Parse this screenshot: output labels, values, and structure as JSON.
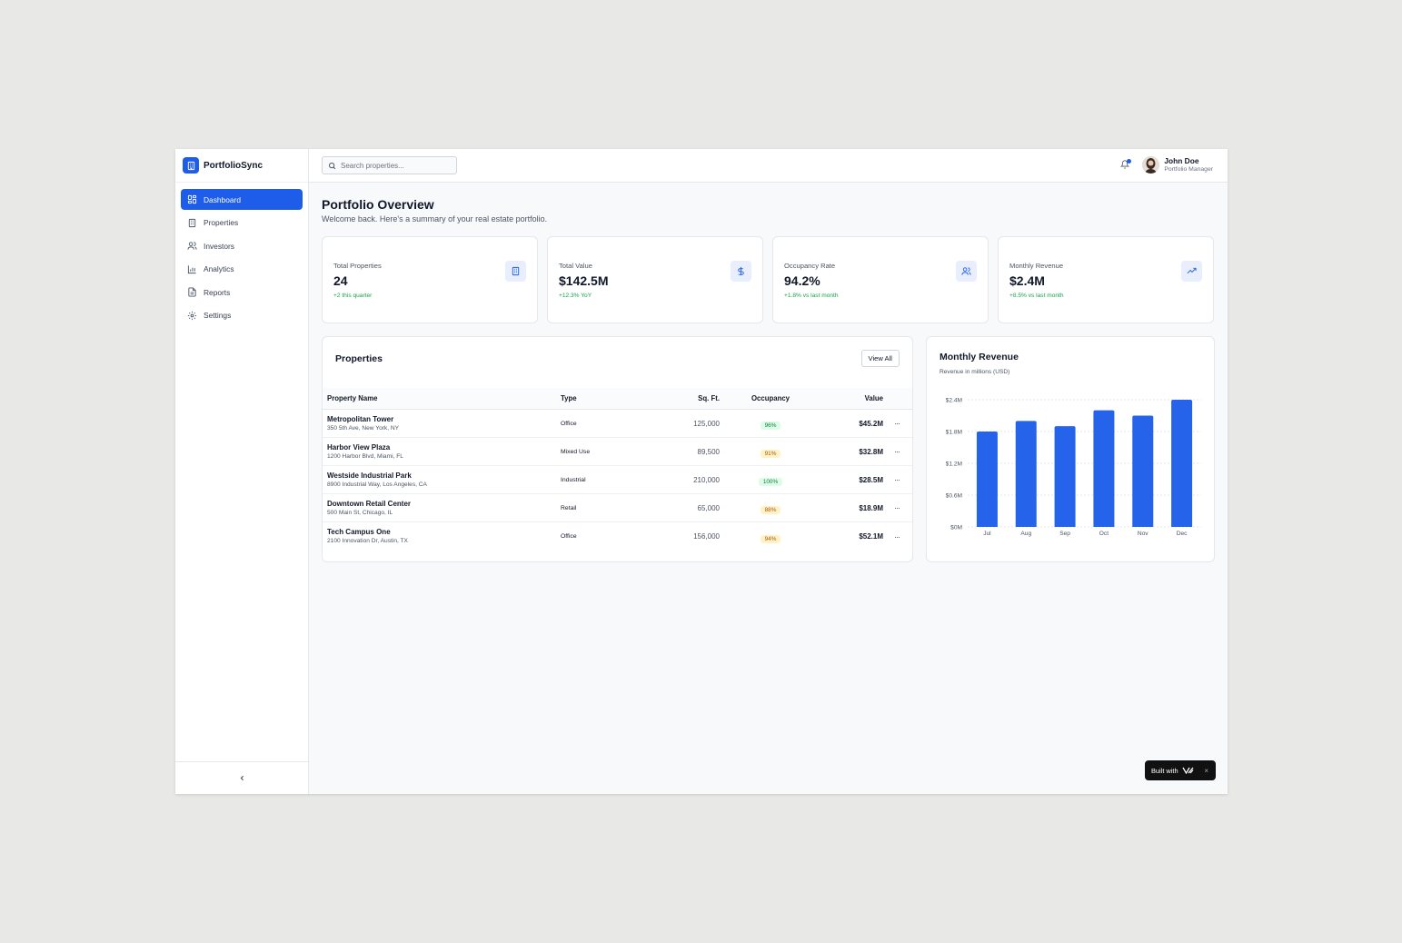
{
  "brand": {
    "name": "PortfolioSync"
  },
  "nav": [
    {
      "label": "Dashboard",
      "icon": "grid-icon",
      "active": true
    },
    {
      "label": "Properties",
      "icon": "building-icon"
    },
    {
      "label": "Investors",
      "icon": "users-icon"
    },
    {
      "label": "Analytics",
      "icon": "bar-chart-icon"
    },
    {
      "label": "Reports",
      "icon": "document-icon"
    },
    {
      "label": "Settings",
      "icon": "gear-icon"
    }
  ],
  "search": {
    "placeholder": "Search properties..."
  },
  "user": {
    "name": "John Doe",
    "role": "Portfolio Manager"
  },
  "page": {
    "title": "Portfolio Overview",
    "subtitle": "Welcome back. Here's a summary of your real estate portfolio."
  },
  "stats": [
    {
      "label": "Total Properties",
      "value": "24",
      "change": "+2 this quarter",
      "icon": "building-icon"
    },
    {
      "label": "Total Value",
      "value": "$142.5M",
      "change": "+12.3% YoY",
      "icon": "dollar-icon"
    },
    {
      "label": "Occupancy Rate",
      "value": "94.2%",
      "change": "+1.8% vs last month",
      "icon": "users-icon"
    },
    {
      "label": "Monthly Revenue",
      "value": "$2.4M",
      "change": "+8.5% vs last month",
      "icon": "trending-up-icon"
    }
  ],
  "properties": {
    "title": "Properties",
    "view_all": "View All",
    "columns": [
      "Property Name",
      "Type",
      "Sq. Ft.",
      "Occupancy",
      "Value"
    ],
    "rows": [
      {
        "name": "Metropolitan Tower",
        "address": "350 5th Ave, New York, NY",
        "type": "Office",
        "sqft": "125,000",
        "occupancy": "96%",
        "occ_color": "green",
        "value": "$45.2M"
      },
      {
        "name": "Harbor View Plaza",
        "address": "1200 Harbor Blvd, Miami, FL",
        "type": "Mixed Use",
        "sqft": "89,500",
        "occupancy": "91%",
        "occ_color": "yellow",
        "value": "$32.8M"
      },
      {
        "name": "Westside Industrial Park",
        "address": "8900 Industrial Way, Los Angeles, CA",
        "type": "Industrial",
        "sqft": "210,000",
        "occupancy": "100%",
        "occ_color": "green",
        "value": "$28.5M"
      },
      {
        "name": "Downtown Retail Center",
        "address": "500 Main St, Chicago, IL",
        "type": "Retail",
        "sqft": "65,000",
        "occupancy": "88%",
        "occ_color": "yellow",
        "value": "$18.9M"
      },
      {
        "name": "Tech Campus One",
        "address": "2100 Innovation Dr, Austin, TX",
        "type": "Office",
        "sqft": "156,000",
        "occupancy": "94%",
        "occ_color": "yellow",
        "value": "$52.1M"
      }
    ]
  },
  "chart_data": {
    "type": "bar",
    "title": "Monthly Revenue",
    "subtitle": "Revenue in millions (USD)",
    "categories": [
      "Jul",
      "Aug",
      "Sep",
      "Oct",
      "Nov",
      "Dec"
    ],
    "values": [
      1.8,
      2.0,
      1.9,
      2.2,
      2.1,
      2.4
    ],
    "ylim": [
      0,
      2.4
    ],
    "yticks": [
      "$0M",
      "$0.6M",
      "$1.2M",
      "$1.8M",
      "$2.4M"
    ],
    "color": "#2563eb",
    "grid": true
  },
  "badge": {
    "built_with": "Built with",
    "close": "×"
  },
  "colors": {
    "accent": "#1d5de9",
    "positive": "#16a34a"
  }
}
